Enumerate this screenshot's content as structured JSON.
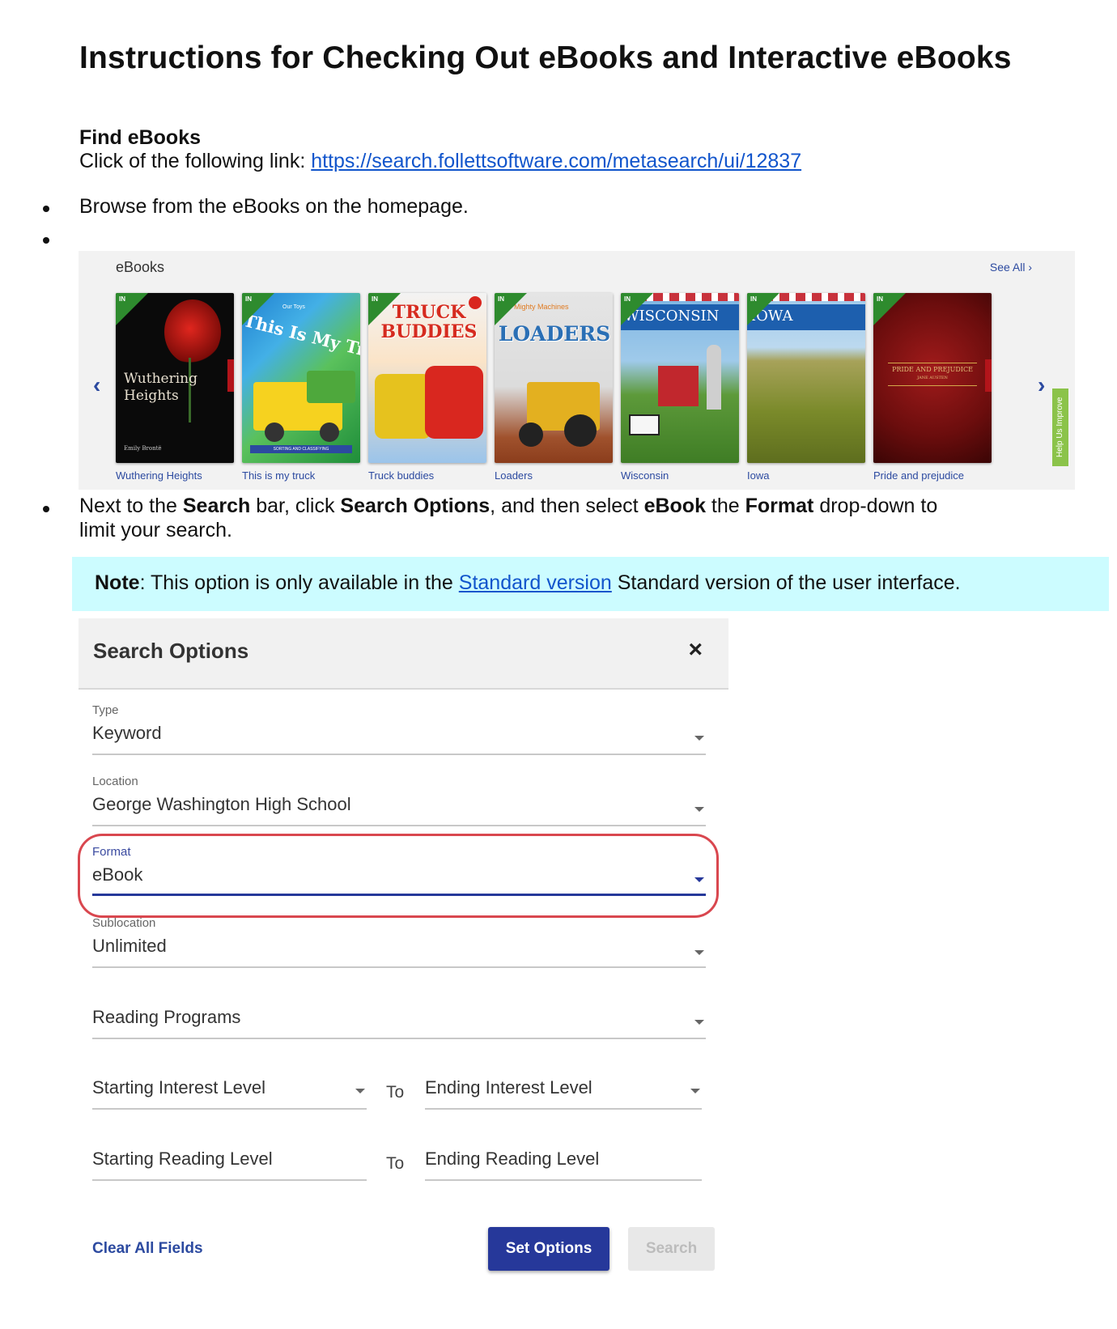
{
  "title": "Instructions for Checking Out eBooks and Interactive eBooks",
  "find": {
    "heading": "Find eBooks",
    "intro": "Click of the following link: ",
    "link": "https://search.follettsoftware.com/metasearch/ui/12837"
  },
  "steps": {
    "browse": "Browse from the eBooks on the homepage.",
    "search_parts": [
      "Next to the ",
      "Search",
      " bar, click ",
      "Search Options",
      ", and then select ",
      "eBook",
      " the ",
      "Format",
      " drop-down to"
    ],
    "search_line2": "limit your search."
  },
  "carousel": {
    "title": "eBooks",
    "see_all": "See All ›",
    "prev": "‹",
    "next": "›",
    "help_tab": "Help Us Improve",
    "badge": "IN",
    "books": [
      {
        "label": "Wuthering Heights",
        "cover_text": "Wuthering Heights",
        "author": "Emily Brontë"
      },
      {
        "label": "This is my truck",
        "cover_text": "This Is My Truck",
        "top_text": "Our Toys",
        "strip_text": "SORTING AND CLASSIFYING"
      },
      {
        "label": "Truck buddies",
        "cover_text": "TRUCK BUDDIES"
      },
      {
        "label": "Loaders",
        "cover_text": "LOADERS",
        "top_text": "Mighty Machines"
      },
      {
        "label": "Wisconsin",
        "cover_text": "WISCONSIN"
      },
      {
        "label": "Iowa",
        "cover_text": "IOWA"
      },
      {
        "label": "Pride and prejudice",
        "cover_text": "PRIDE AND PREJUDICE",
        "author": "JANE AUSTEN"
      }
    ]
  },
  "note": {
    "label": "Note",
    "text_before": ": This option is only available in the ",
    "link": "Standard version",
    "text_after": " Standard version of the user interface."
  },
  "search_options": {
    "title": "Search Options",
    "close": "×",
    "type": {
      "label": "Type",
      "value": "Keyword"
    },
    "location": {
      "label": "Location",
      "value": "George Washington High School"
    },
    "format": {
      "label": "Format",
      "value": "eBook"
    },
    "sublocation": {
      "label": "Sublocation",
      "value": "Unlimited"
    },
    "reading_programs": "Reading Programs",
    "start_interest": "Starting Interest Level",
    "end_interest": "Ending Interest Level",
    "start_reading": "Starting Reading Level",
    "end_reading": "Ending Reading Level",
    "to": "To",
    "clear": "Clear All Fields",
    "set": "Set Options",
    "search": "Search"
  },
  "colors": {
    "link": "#1155cc",
    "accent": "#26389a",
    "note_bg": "#ccfcff",
    "highlight": "#d9474f",
    "badge": "#2e8b2e"
  }
}
